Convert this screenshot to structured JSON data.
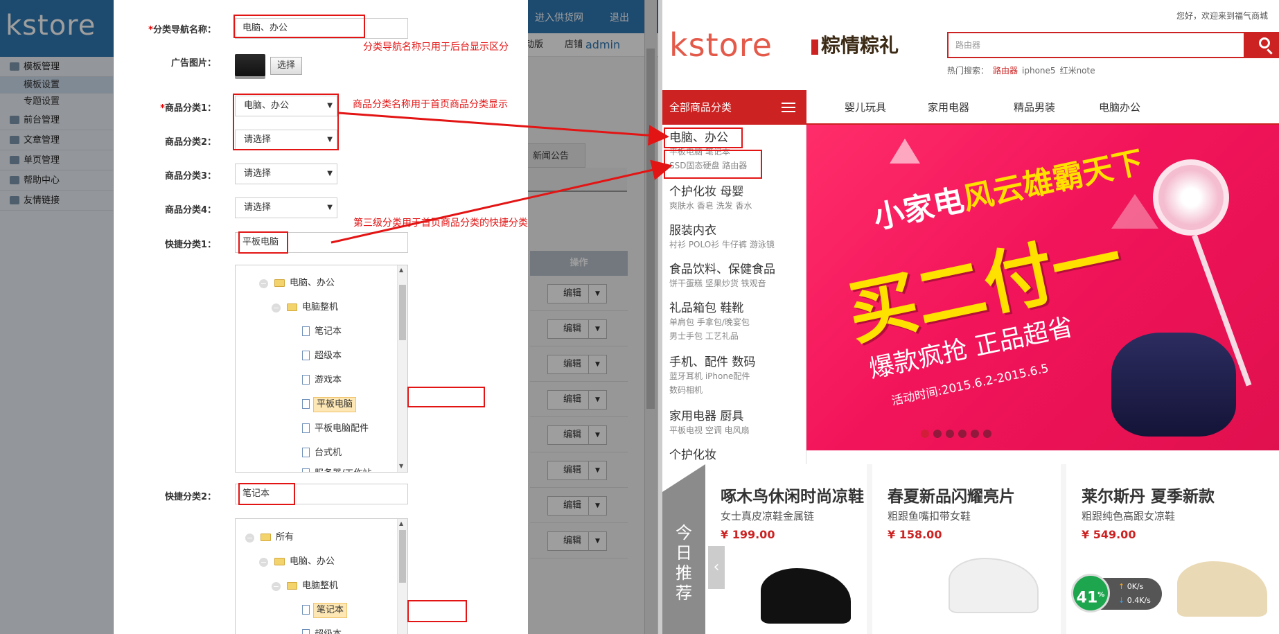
{
  "admin": {
    "logo": "kstore",
    "top_links": {
      "supplier": "进入供货网",
      "logout": "退出"
    },
    "top_banner": "动版",
    "top_shop": "店铺",
    "top_user": "admin",
    "sidebar": [
      {
        "label": "模板管理",
        "subs": [
          "模板设置",
          "专题设置"
        ]
      },
      {
        "label": "前台管理"
      },
      {
        "label": "文章管理"
      },
      {
        "label": "单页管理"
      },
      {
        "label": "帮助中心"
      },
      {
        "label": "友情链接"
      }
    ],
    "tab_news": "新闻公告",
    "table_col_op": "操作",
    "row_edit": "编辑"
  },
  "dialog": {
    "nav_name": {
      "label": "分类导航名称：",
      "value": "电脑、办公"
    },
    "ad_image": {
      "label": "广告图片：",
      "button": "选择"
    },
    "cat1": {
      "label": "商品分类1：",
      "value": "电脑、办公"
    },
    "cat2": {
      "label": "商品分类2：",
      "value": "请选择"
    },
    "cat3": {
      "label": "商品分类3：",
      "value": "请选择"
    },
    "cat4": {
      "label": "商品分类4：",
      "value": "请选择"
    },
    "quick1": {
      "label": "快捷分类1：",
      "value": "平板电脑"
    },
    "quick2": {
      "label": "快捷分类2：",
      "value": "笔记本"
    },
    "tree1": [
      "电脑、办公",
      "电脑整机",
      "笔记本",
      "超级本",
      "游戏本",
      "平板电脑",
      "平板电脑配件",
      "台式机",
      "服务器/工作站"
    ],
    "tree2": [
      "所有",
      "电脑、办公",
      "电脑整机",
      "笔记本",
      "超级本"
    ]
  },
  "annotations": {
    "a1": "分类导航名称只用于后台显示区分",
    "a2": "商品分类名称用于首页商品分类显示",
    "a3": "第三级分类用于首页商品分类的快捷分类"
  },
  "store": {
    "greeting": "您好，欢迎来到福气商城",
    "logo": "kstore",
    "promo_logo": "粽情粽礼",
    "search_placeholder": "路由器",
    "hot_label": "热门搜索：",
    "hot_keywords": [
      "路由器",
      "iphone5",
      "红米note"
    ],
    "all_categories": "全部商品分类",
    "nav": [
      "婴儿玩具",
      "家用电器",
      "精品男装",
      "电脑办公"
    ],
    "categories": [
      {
        "title": "电脑、办公",
        "subs": [
          "平板电脑 笔记本",
          "SSD固态硬盘 路由器"
        ]
      },
      {
        "title": "个护化妆  母婴",
        "subs": [
          "爽肤水 香皂 洗发 香水"
        ]
      },
      {
        "title": "服装内衣",
        "subs": [
          "衬衫 POLO衫 牛仔裤 游泳镜"
        ]
      },
      {
        "title": "食品饮料、保健食品",
        "subs": [
          "饼干蛋糕 坚果炒货 铁观音"
        ]
      },
      {
        "title": "礼品箱包  鞋靴",
        "subs": [
          "单肩包 手拿包/晚宴包",
          "男士手包 工艺礼品"
        ]
      },
      {
        "title": "手机、配件  数码",
        "subs": [
          "蓝牙耳机 iPhone配件",
          "数码相机"
        ]
      },
      {
        "title": "家用电器  厨具",
        "subs": [
          "平板电视 空调 电风扇"
        ]
      },
      {
        "title": "个护化妆",
        "subs": []
      }
    ],
    "banner": {
      "line1_a": "小家电",
      "line1_b": "风云雄霸天下",
      "line2": "买二付一",
      "line3": "爆款疯抢 正品超省",
      "line4": "活动时间:2015.6.2-2015.6.5"
    },
    "recommend_label": "今日推荐",
    "products": [
      {
        "name": "啄木鸟休闲时尚凉鞋",
        "desc": "女士真皮凉鞋金属链",
        "price": "¥ 199.00"
      },
      {
        "name": "春夏新品闪耀亮片",
        "desc": "粗跟鱼嘴扣带女鞋",
        "price": "¥ 158.00"
      },
      {
        "name": "莱尔斯丹 夏季新款",
        "desc": "粗跟纯色高跟女凉鞋",
        "price": "¥ 549.00"
      }
    ],
    "speed": {
      "percent": "41",
      "unit": "%",
      "up": "0K/s",
      "down": "0.4K/s"
    }
  }
}
